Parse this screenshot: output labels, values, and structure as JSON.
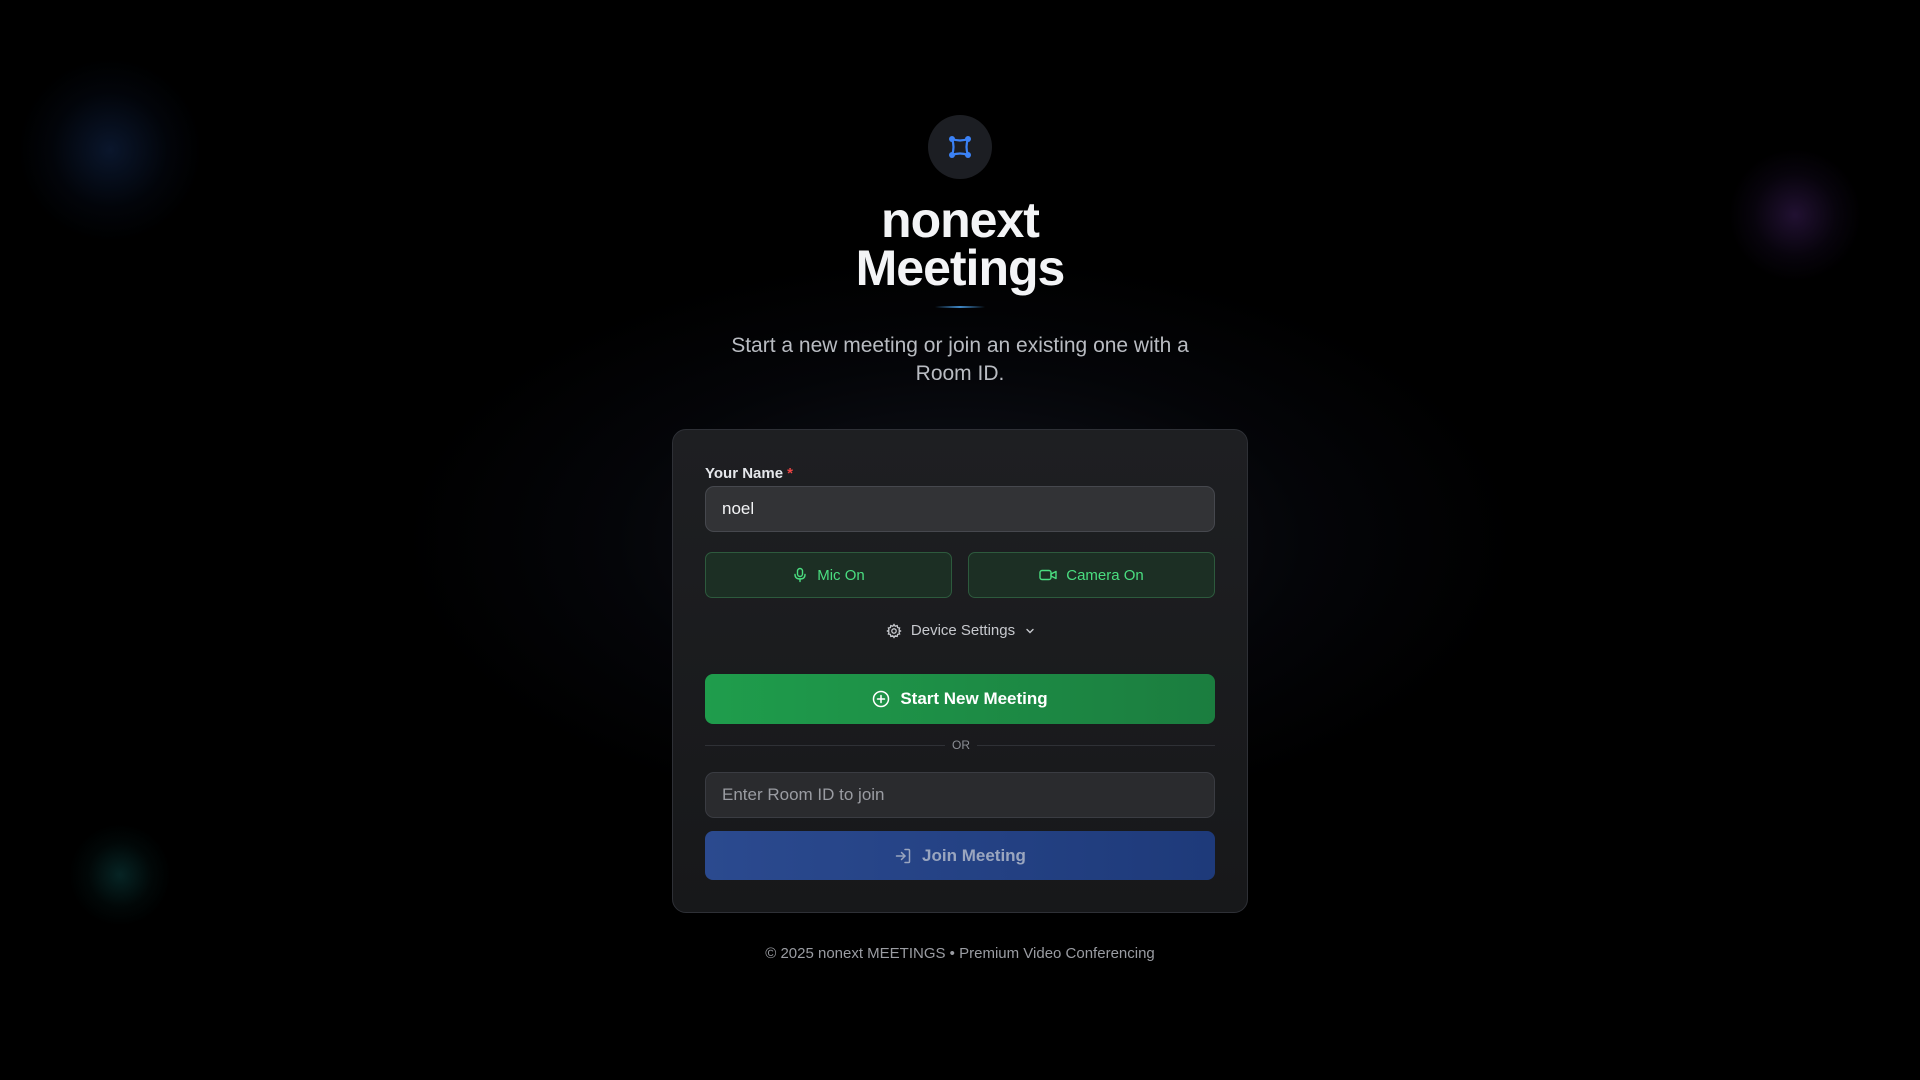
{
  "app": {
    "title_line1": "nonext",
    "title_line2": "Meetings",
    "subtitle": "Start a new meeting or join an existing one with a Room ID.",
    "logo_icon": "network-nodes-icon",
    "accent_color": "#3b82f6"
  },
  "form": {
    "name_label": "Your Name",
    "required_marker": "*",
    "name_value": "noel",
    "mic_label": "Mic On",
    "mic_icon": "microphone-icon",
    "camera_label": "Camera On",
    "camera_icon": "video-camera-icon",
    "device_settings_label": "Device Settings",
    "device_settings_icon": "gear-icon",
    "start_label": "Start New Meeting",
    "start_icon": "plus-circle-icon",
    "divider_text": "OR",
    "room_placeholder": "Enter Room ID to join",
    "room_value": "",
    "join_label": "Join Meeting",
    "join_icon": "login-arrow-icon"
  },
  "colors": {
    "start_button": "#1f9d4c",
    "join_button": "#2b4a8f",
    "toggle_text": "#4ade80",
    "required_star": "#ef4444"
  },
  "footer": {
    "text": "© 2025 nonext MEETINGS • Premium Video Conferencing"
  }
}
